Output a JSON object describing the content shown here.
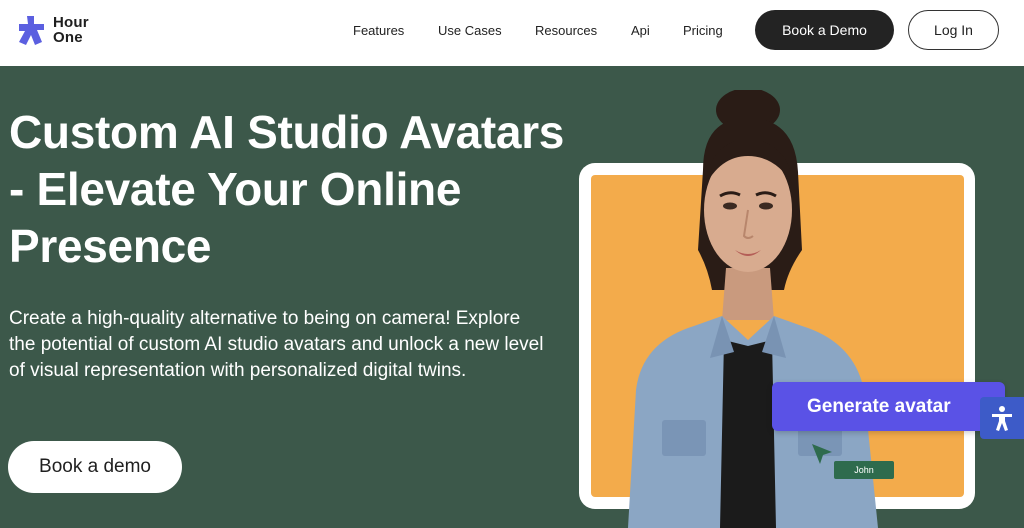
{
  "brand": {
    "line1": "Hour",
    "line2": "One"
  },
  "nav": [
    {
      "label": "Features"
    },
    {
      "label": "Use Cases"
    },
    {
      "label": "Resources"
    },
    {
      "label": "Api"
    },
    {
      "label": "Pricing"
    }
  ],
  "header": {
    "book_demo": "Book a Demo",
    "login": "Log In"
  },
  "hero": {
    "title": "Custom AI Studio Avatars - Elevate Your Online Presence",
    "description": "Create a high-quality alternative to being on camera! Explore the potential of custom AI studio avatars and unlock a new level of visual representation with personalized digital twins.",
    "cta": "Book a demo"
  },
  "visual": {
    "generate_label": "Generate avatar",
    "name_tag": "John"
  },
  "colors": {
    "hero_bg": "#3c584a",
    "card_bg": "#f3ab4b",
    "accent_purple": "#5a52e6",
    "logo_blue": "#5b5fe0",
    "accessibility_blue": "#3d5bc8"
  },
  "icons": [
    "logo-star-icon",
    "cursor-arrow-icon",
    "accessibility-icon"
  ]
}
